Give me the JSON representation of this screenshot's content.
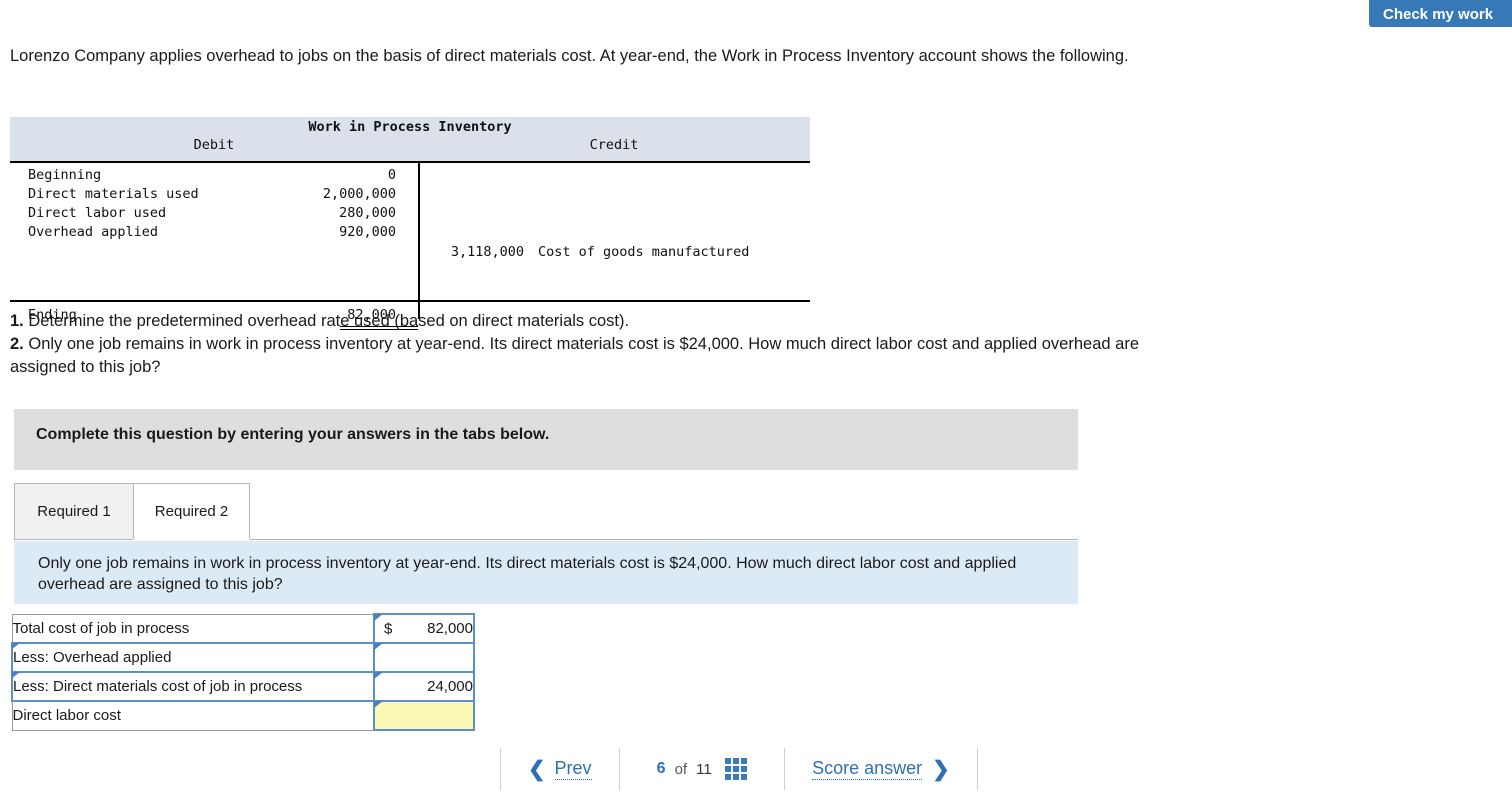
{
  "toolbar": {
    "check_my_work_label": "Check my work"
  },
  "intro": {
    "text": "Lorenzo Company applies overhead to jobs on the basis of direct materials cost. At year-end, the Work in Process Inventory account shows the following."
  },
  "taccount": {
    "title": "Work in Process Inventory",
    "debit_header": "Debit",
    "credit_header": "Credit",
    "debit_rows": [
      {
        "label": "Beginning",
        "amount": "0"
      },
      {
        "label": "Direct materials used",
        "amount": "2,000,000"
      },
      {
        "label": "Direct labor used",
        "amount": "280,000"
      },
      {
        "label": "Overhead applied",
        "amount": "920,000"
      }
    ],
    "credit_row": {
      "amount": "3,118,000",
      "label": "Cost of goods manufactured"
    },
    "ending": {
      "label": "Ending",
      "amount": "82,000"
    }
  },
  "requirements": [
    {
      "number": "1.",
      "text": "Determine the predetermined overhead rate used (based on direct materials cost)."
    },
    {
      "number": "2.",
      "text": "Only one job remains in work in process inventory at year-end. Its direct materials cost is $24,000. How much direct labor cost and applied overhead are assigned to this job?"
    }
  ],
  "instruction": {
    "text": "Complete this question by entering your answers in the tabs below."
  },
  "tabs": [
    {
      "label": "Required 1",
      "active": false
    },
    {
      "label": "Required 2",
      "active": true
    }
  ],
  "question": {
    "text": "Only one job remains in work in process inventory at year-end. Its direct materials cost is $24,000. How much direct labor cost and applied overhead are assigned to this job?"
  },
  "answer_table": {
    "rows": [
      {
        "label": "Total cost of job in process",
        "currency": "$",
        "value": "82,000",
        "highlight": false,
        "label_marker": false,
        "value_marker": true
      },
      {
        "label": "Less: Overhead applied",
        "currency": "",
        "value": "",
        "highlight": false,
        "label_marker": true,
        "value_marker": true
      },
      {
        "label": "Less: Direct materials cost of job in process",
        "currency": "",
        "value": "24,000",
        "highlight": false,
        "label_marker": true,
        "value_marker": true
      },
      {
        "label": "Direct labor cost",
        "currency": "",
        "value": "",
        "highlight": true,
        "label_marker": false,
        "value_marker": true
      }
    ]
  },
  "bottom_nav": {
    "prev_label": "Prev",
    "prev_icon": "chevron-left-icon",
    "page_current": "6",
    "page_of": "of",
    "page_total": "11",
    "grid_icon": "grid-icon",
    "score_label": "Score answer",
    "next_icon": "chevron-right-icon"
  },
  "colors": {
    "accent_blue": "#3778b7",
    "panel_gray": "#dedede",
    "question_blue": "#dceaf6",
    "taccount_header": "#dbe1ea",
    "input_border": "#5b8fc9",
    "highlight_yellow": "#fbf7b5",
    "link_blue": "#2f6fb5"
  }
}
